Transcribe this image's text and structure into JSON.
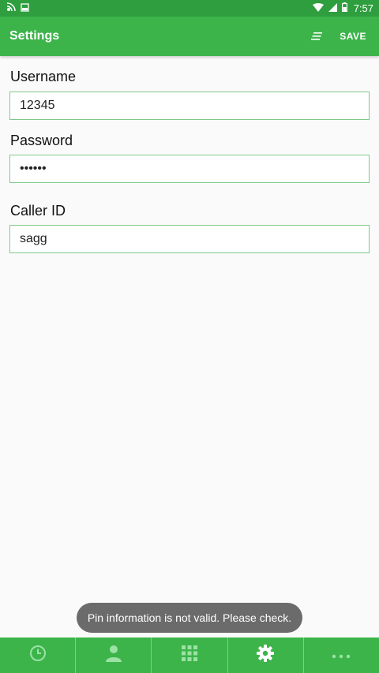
{
  "status_bar": {
    "time": "7:57",
    "icons": [
      "cast-icon",
      "image-icon",
      "wifi-icon",
      "signal-icon",
      "battery-icon"
    ]
  },
  "app_bar": {
    "title": "Settings",
    "save_label": "SAVE",
    "menu_icon": "sort-icon"
  },
  "form": {
    "username": {
      "label": "Username",
      "value": "12345"
    },
    "password": {
      "label": "Password",
      "value": "••••••"
    },
    "caller_id": {
      "label": "Caller ID",
      "value": "sagg"
    }
  },
  "toast": {
    "message": "Pin information is not valid. Please check."
  },
  "bottom_nav": {
    "items": [
      {
        "icon": "clock-icon",
        "active": false
      },
      {
        "icon": "person-icon",
        "active": false
      },
      {
        "icon": "dialpad-icon",
        "active": false
      },
      {
        "icon": "gear-icon",
        "active": true
      },
      {
        "icon": "more-icon",
        "active": false
      }
    ]
  },
  "colors": {
    "status_bar": "#2e9e3e",
    "primary": "#3cb44a",
    "input_border": "#7fc98a",
    "toast_bg": "#6b6b6b",
    "background": "#fafafa"
  }
}
